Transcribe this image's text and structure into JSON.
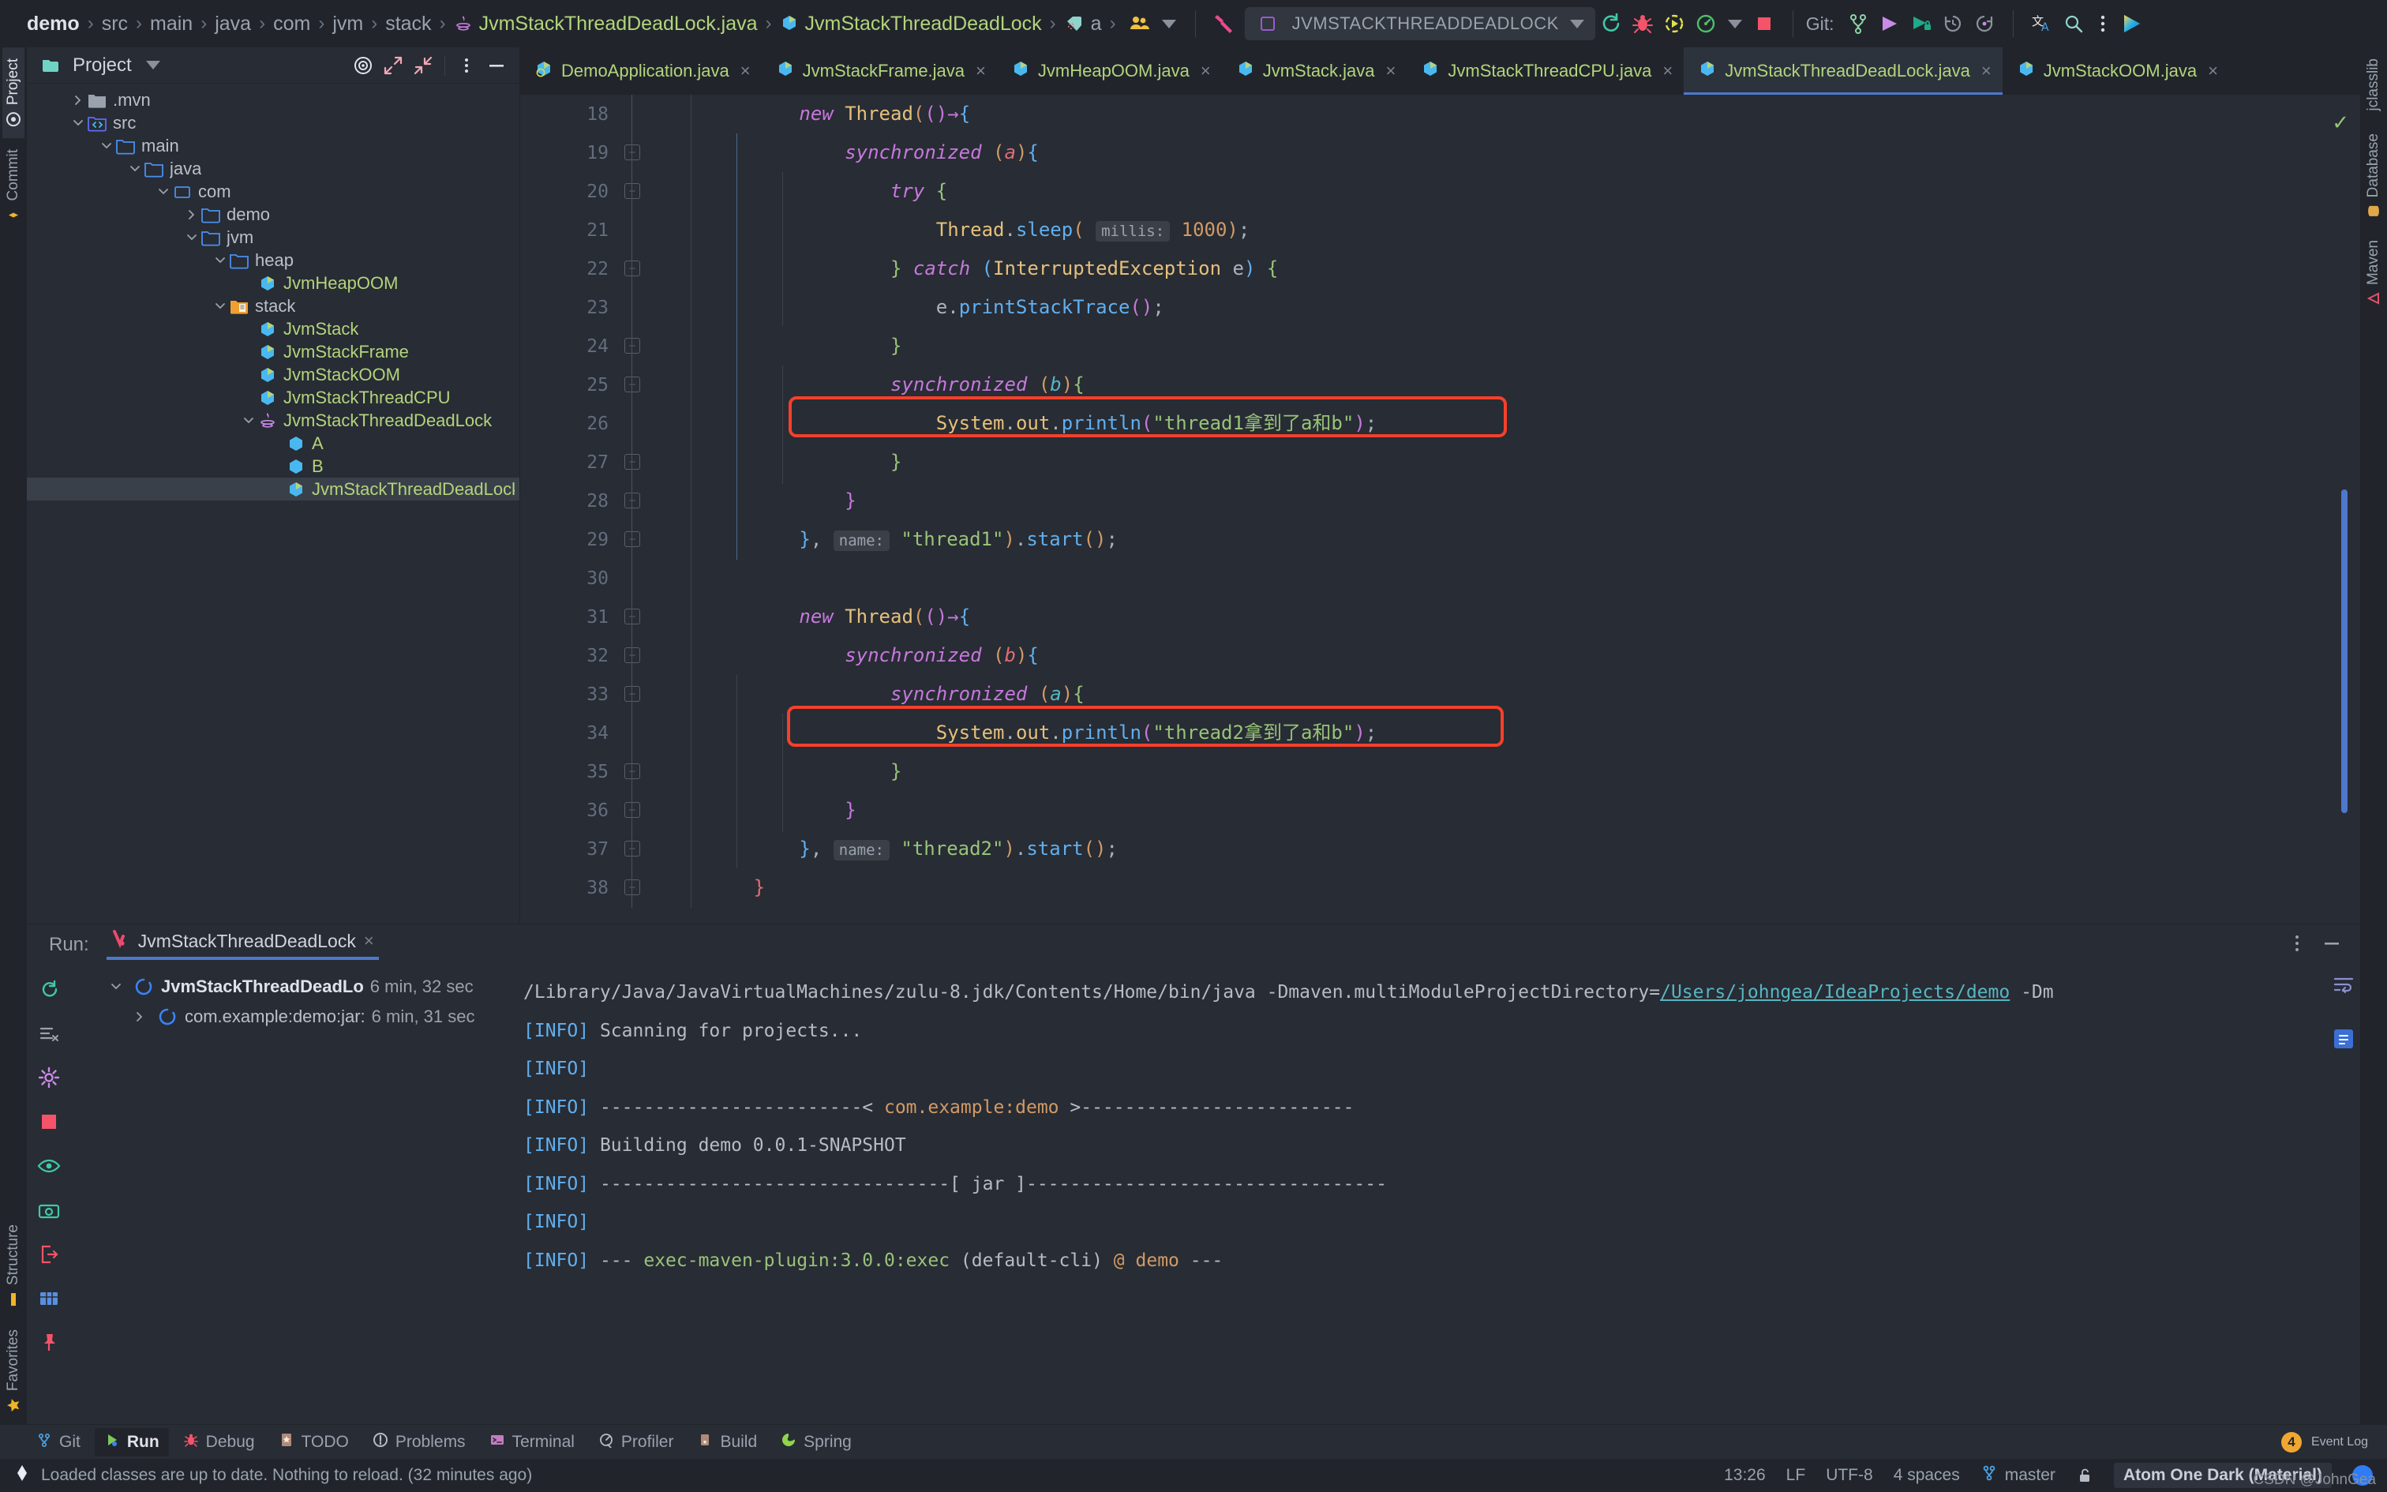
{
  "toolbar": {
    "breadcrumbs": [
      {
        "label": "demo",
        "kind": "root"
      },
      {
        "label": "src",
        "kind": "dir"
      },
      {
        "label": "main",
        "kind": "dir"
      },
      {
        "label": "java",
        "kind": "dir"
      },
      {
        "label": "com",
        "kind": "dir"
      },
      {
        "label": "jvm",
        "kind": "dir"
      },
      {
        "label": "stack",
        "kind": "dir"
      },
      {
        "label": "JvmStackThreadDeadLock.java",
        "kind": "file",
        "icon": "java-file-icon"
      },
      {
        "label": "JvmStackThreadDeadLock",
        "kind": "file",
        "icon": "java-class-icon"
      },
      {
        "label": "a",
        "kind": "file",
        "icon": "field-icon"
      }
    ],
    "separator": "›",
    "icons": {
      "people": "people-icon",
      "hammer": "build-hammer-icon",
      "rerun": "rerun-icon",
      "debug": "debug-bug-icon",
      "run_coverage": "run-with-coverage-icon",
      "profiler": "profiler-icon",
      "stop": "stop-icon",
      "branch": "git-branch-icon",
      "push": "git-push-icon",
      "update": "git-update-icon",
      "history": "history-icon",
      "rollback": "rollback-icon",
      "translate": "translate-icon",
      "search": "search-icon",
      "more": "more-vertical-icon",
      "ide_logo": "ide-logo-icon"
    },
    "run_config": {
      "name": "JVMSTACKTHREADDEADLOCK",
      "icon": "run-config-icon"
    },
    "git_label": "Git:"
  },
  "left_strip": {
    "tabs": [
      {
        "label": "Project",
        "icon": "project-icon",
        "active": true
      },
      {
        "label": "Commit",
        "icon": "commit-icon",
        "active": false
      },
      {
        "label": "Structure",
        "icon": "structure-icon",
        "active": false
      },
      {
        "label": "Favorites",
        "icon": "favorites-star-icon",
        "active": false
      }
    ]
  },
  "right_strip": {
    "tabs": [
      {
        "label": "jclasslib",
        "icon": "jclasslib-icon"
      },
      {
        "label": "Database",
        "icon": "database-icon"
      },
      {
        "label": "Maven",
        "icon": "maven-icon"
      }
    ]
  },
  "project_panel": {
    "title": "Project",
    "dropdown_icon": "chevron-down-icon",
    "actions": [
      "locate-icon",
      "expand-all-icon",
      "collapse-all-icon",
      "more-vertical-icon",
      "hide-icon"
    ],
    "tree": [
      {
        "label": ".mvn",
        "depth": 1,
        "state": "collapsed",
        "icon": "folder-gray-icon",
        "green": false,
        "selected": false
      },
      {
        "label": "src",
        "depth": 1,
        "state": "expanded",
        "icon": "source-root-icon",
        "green": false,
        "selected": false
      },
      {
        "label": "main",
        "depth": 2,
        "state": "expanded",
        "icon": "folder-blue-icon",
        "green": false,
        "selected": false
      },
      {
        "label": "java",
        "depth": 3,
        "state": "expanded",
        "icon": "folder-blue-icon",
        "green": false,
        "selected": false
      },
      {
        "label": "com",
        "depth": 4,
        "state": "expanded",
        "icon": "package-icon",
        "green": false,
        "selected": false
      },
      {
        "label": "demo",
        "depth": 5,
        "state": "collapsed",
        "icon": "folder-blue-icon",
        "green": false,
        "selected": false
      },
      {
        "label": "jvm",
        "depth": 5,
        "state": "expanded",
        "icon": "folder-blue-icon",
        "green": false,
        "selected": false
      },
      {
        "label": "heap",
        "depth": 6,
        "state": "expanded",
        "icon": "folder-blue-icon",
        "green": false,
        "selected": false
      },
      {
        "label": "JvmHeapOOM",
        "depth": 7,
        "state": "leaf",
        "icon": "java-class-icon",
        "green": true,
        "selected": false
      },
      {
        "label": "stack",
        "depth": 6,
        "state": "expanded",
        "icon": "folder-orange-icon",
        "green": false,
        "selected": false
      },
      {
        "label": "JvmStack",
        "depth": 7,
        "state": "leaf",
        "icon": "java-class-icon",
        "green": true,
        "selected": false
      },
      {
        "label": "JvmStackFrame",
        "depth": 7,
        "state": "leaf",
        "icon": "java-class-icon",
        "green": true,
        "selected": false
      },
      {
        "label": "JvmStackOOM",
        "depth": 7,
        "state": "leaf",
        "icon": "java-class-icon",
        "green": true,
        "selected": false
      },
      {
        "label": "JvmStackThreadCPU",
        "depth": 7,
        "state": "leaf",
        "icon": "java-class-icon",
        "green": true,
        "selected": false
      },
      {
        "label": "JvmStackThreadDeadLock",
        "depth": 7,
        "state": "expanded",
        "icon": "java-runnable-icon",
        "green": true,
        "selected": false
      },
      {
        "label": "A",
        "depth": 8,
        "state": "leaf",
        "icon": "java-class-plain-icon",
        "green": true,
        "selected": false
      },
      {
        "label": "B",
        "depth": 8,
        "state": "leaf",
        "icon": "java-class-plain-icon",
        "green": true,
        "selected": false
      },
      {
        "label": "JvmStackThreadDeadLock",
        "depth": 8,
        "state": "leaf",
        "icon": "java-class-icon",
        "green": true,
        "selected": true
      }
    ]
  },
  "editor": {
    "tabs": [
      {
        "label": "DemoApplication.java",
        "icon": "java-runnable-file-icon",
        "active": false
      },
      {
        "label": "JvmStackFrame.java",
        "icon": "java-file-icon",
        "active": false
      },
      {
        "label": "JvmHeapOOM.java",
        "icon": "java-file-icon",
        "active": false
      },
      {
        "label": "JvmStack.java",
        "icon": "java-file-icon",
        "active": false
      },
      {
        "label": "JvmStackThreadCPU.java",
        "icon": "java-file-icon",
        "active": false
      },
      {
        "label": "JvmStackThreadDeadLock.java",
        "icon": "java-file-icon",
        "active": true
      },
      {
        "label": "JvmStackOOM.java",
        "icon": "java-file-icon",
        "active": false
      }
    ],
    "close_glyph": "×",
    "first_visible_line": 18,
    "line_numbers": [
      18,
      19,
      20,
      21,
      22,
      23,
      24,
      25,
      26,
      27,
      28,
      29,
      30,
      31,
      32,
      33,
      34,
      35,
      36,
      37,
      38
    ],
    "lines": [
      "            new Thread(()->{",
      "                synchronized (a){",
      "                    try {",
      "                        Thread.sleep( millis: 1000);",
      "                    } catch (InterruptedException e) {",
      "                        e.printStackTrace();",
      "                    }",
      "                    synchronized (b){",
      "                        System.out.println(\"thread1拿到了a和b\");",
      "                    }",
      "                }",
      "            }, name: \"thread1\").start();",
      "",
      "            new Thread(()->{",
      "                synchronized (b){",
      "                    synchronized (a){",
      "                        System.out.println(\"thread2拿到了a和b\");",
      "                    }",
      "                }",
      "            }, name: \"thread2\").start();",
      "        }"
    ],
    "inlay_hints": [
      "millis:",
      "name:",
      "name:"
    ],
    "highlighted_lines": [
      26,
      34
    ],
    "highlight_color": "#f5402c",
    "string_literal_1": "\"thread1拿到了a和b\"",
    "string_literal_2": "\"thread2拿到了a和b\"",
    "inspection_status": "ok-check-icon"
  },
  "run_panel": {
    "label": "Run:",
    "tab": {
      "label": "JvmStackThreadDeadLock",
      "icon": "junit-run-icon",
      "close": "×"
    },
    "tools": [
      "rerun-icon",
      "clear-all-icon",
      "settings-gear-icon",
      "stop-red-icon",
      "eye-icon",
      "camera-icon",
      "export-icon",
      "table-icon",
      "pin-icon"
    ],
    "header_actions": [
      "more-vertical-icon",
      "minimize-icon"
    ],
    "tree": [
      {
        "name": "JvmStackThreadDeadLo",
        "duration": "6 min, 32 sec",
        "state": "expanded",
        "bold": true
      },
      {
        "name": "com.example:demo:jar:",
        "duration": "6 min, 31 sec",
        "state": "collapsed",
        "bold": false
      }
    ],
    "console": [
      {
        "segments": [
          {
            "t": "/Library/Java/JavaVirtualMachines/zulu-8.jdk/Contents/Home/bin/java -Dmaven.multiModuleProjectDirectory=",
            "c": "plain"
          },
          {
            "t": "/Users/johngea/IdeaProjects/demo",
            "c": "link"
          },
          {
            "t": " -Dm",
            "c": "plain"
          }
        ]
      },
      {
        "segments": [
          {
            "t": "[INFO]",
            "c": "info"
          },
          {
            "t": " Scanning for projects...",
            "c": "dim"
          }
        ]
      },
      {
        "segments": [
          {
            "t": "[INFO]",
            "c": "info"
          }
        ]
      },
      {
        "segments": [
          {
            "t": "[INFO]",
            "c": "info"
          },
          {
            "t": " ------------------------< ",
            "c": "dim"
          },
          {
            "t": "com.example:demo",
            "c": "gold"
          },
          {
            "t": " >-------------------------",
            "c": "dim"
          }
        ]
      },
      {
        "segments": [
          {
            "t": "[INFO]",
            "c": "info"
          },
          {
            "t": " Building demo 0.0.1-SNAPSHOT",
            "c": "dim"
          }
        ]
      },
      {
        "segments": [
          {
            "t": "[INFO]",
            "c": "info"
          },
          {
            "t": " --------------------------------[ ",
            "c": "dim"
          },
          {
            "t": "jar",
            "c": "dim"
          },
          {
            "t": " ]---------------------------------",
            "c": "dim"
          }
        ]
      },
      {
        "segments": [
          {
            "t": "[INFO]",
            "c": "info"
          }
        ]
      },
      {
        "segments": [
          {
            "t": "[INFO]",
            "c": "info"
          },
          {
            "t": " --- ",
            "c": "dim"
          },
          {
            "t": "exec-maven-plugin:3.0.0:exec",
            "c": "lime"
          },
          {
            "t": " (default-cli)",
            "c": "dim"
          },
          {
            "t": " @ ",
            "c": "gold"
          },
          {
            "t": "demo",
            "c": "gold"
          },
          {
            "t": " ---",
            "c": "dim"
          }
        ]
      }
    ],
    "console_side_icons": [
      "soft-wrap-icon",
      "scroll-end-icon"
    ]
  },
  "toolwindow_bar": {
    "items": [
      {
        "label": "Git",
        "icon": "git-branch-icon",
        "active": false
      },
      {
        "label": "Run",
        "icon": "run-green-icon",
        "active": true
      },
      {
        "label": "Debug",
        "icon": "debug-bug-icon",
        "active": false
      },
      {
        "label": "TODO",
        "icon": "todo-icon",
        "active": false
      },
      {
        "label": "Problems",
        "icon": "problems-icon",
        "active": false
      },
      {
        "label": "Terminal",
        "icon": "terminal-icon",
        "active": false
      },
      {
        "label": "Profiler",
        "icon": "profiler-icon",
        "active": false
      },
      {
        "label": "Build",
        "icon": "build-icon",
        "active": false
      },
      {
        "label": "Spring",
        "icon": "spring-leaf-icon",
        "active": false
      }
    ],
    "event_log": {
      "label": "Event Log",
      "count": "4"
    }
  },
  "status_bar": {
    "message": "Loaded classes are up to date. Nothing to reload. (32 minutes ago)",
    "message_icon": "hotswap-icon",
    "time": "13:26",
    "line_separator": "LF",
    "encoding": "UTF-8",
    "indent": "4 spaces",
    "branch": "master",
    "branch_icon": "git-branch-icon",
    "lock_icon": "lock-open-icon",
    "theme": "Atom One Dark (Material)",
    "avatar": "user-avatar"
  },
  "watermark": "CSDN @JohnGea"
}
